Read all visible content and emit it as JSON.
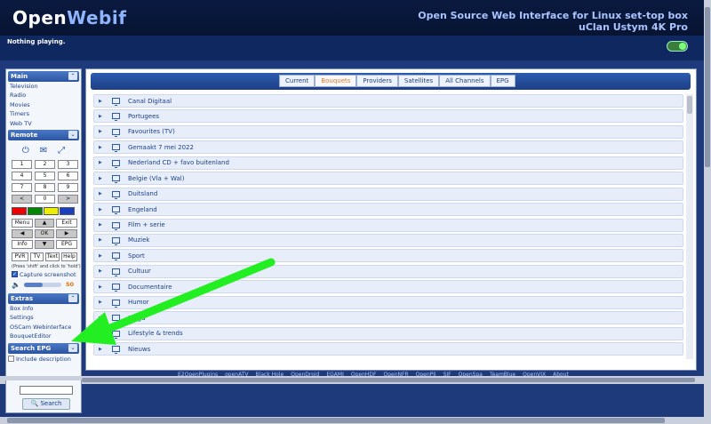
{
  "header": {
    "logo_open": "Open",
    "logo_webif": "Webif",
    "line1": "Open Source Web Interface for Linux set-top box",
    "line2": "uClan Ustym 4K Pro"
  },
  "status": {
    "now_playing": "Nothing playing."
  },
  "sidebar": {
    "main_title": "Main",
    "main_items": [
      "Television",
      "Radio",
      "Movies",
      "Timers",
      "Web TV"
    ],
    "remote_title": "Remote",
    "keys": [
      "1",
      "2",
      "3",
      "4",
      "5",
      "6",
      "7",
      "8",
      "9",
      "<",
      "0",
      ">"
    ],
    "nav_keys": [
      "Menu",
      "▲",
      "Exit",
      "◀",
      "OK",
      "▶",
      "Info",
      "▼",
      "EPG"
    ],
    "func_keys": [
      "PVR",
      "TV",
      "Text",
      "Help"
    ],
    "hint": "(Press 'shift' and click to 'hold')",
    "capture_label": "Capture screenshot",
    "volume": 50,
    "extras_title": "Extras",
    "extras_items": [
      "Box Info",
      "Settings",
      "OSCam Webinterface",
      "BouquetEditor"
    ],
    "search_epg_title": "Search EPG",
    "include_description": "Include description",
    "search_button": "Search"
  },
  "tabs": [
    "Current",
    "Bouquets",
    "Providers",
    "Satellites",
    "All Channels",
    "EPG"
  ],
  "active_tab": "Bouquets",
  "bouquets": [
    "Canal Digitaal",
    "Portugees",
    "Favourites (TV)",
    "Gemaakt 7 mei 2022",
    "Nederland CD + favo buitenland",
    "Belgie (Vla + Wal)",
    "Duitsland",
    "Engeland",
    "Film + serie",
    "Muziek",
    "Sport",
    "Cultuur",
    "Documentaire",
    "Humor",
    "Jeugd",
    "Lifestyle & trends",
    "Nieuws"
  ],
  "footer_links": [
    "E2OpenPlugins",
    "openATV",
    "Black Hole",
    "OpenDroid",
    "EGAMI",
    "OpenHDF",
    "OpenNFR",
    "OpenPli",
    "SIF",
    "OpenSpa",
    "TeamBlue",
    "OpenVIX",
    "About"
  ],
  "colors": {
    "accent": "#2c55a0",
    "active_tab": "#e07a1f",
    "arrow": "#22ee22"
  }
}
